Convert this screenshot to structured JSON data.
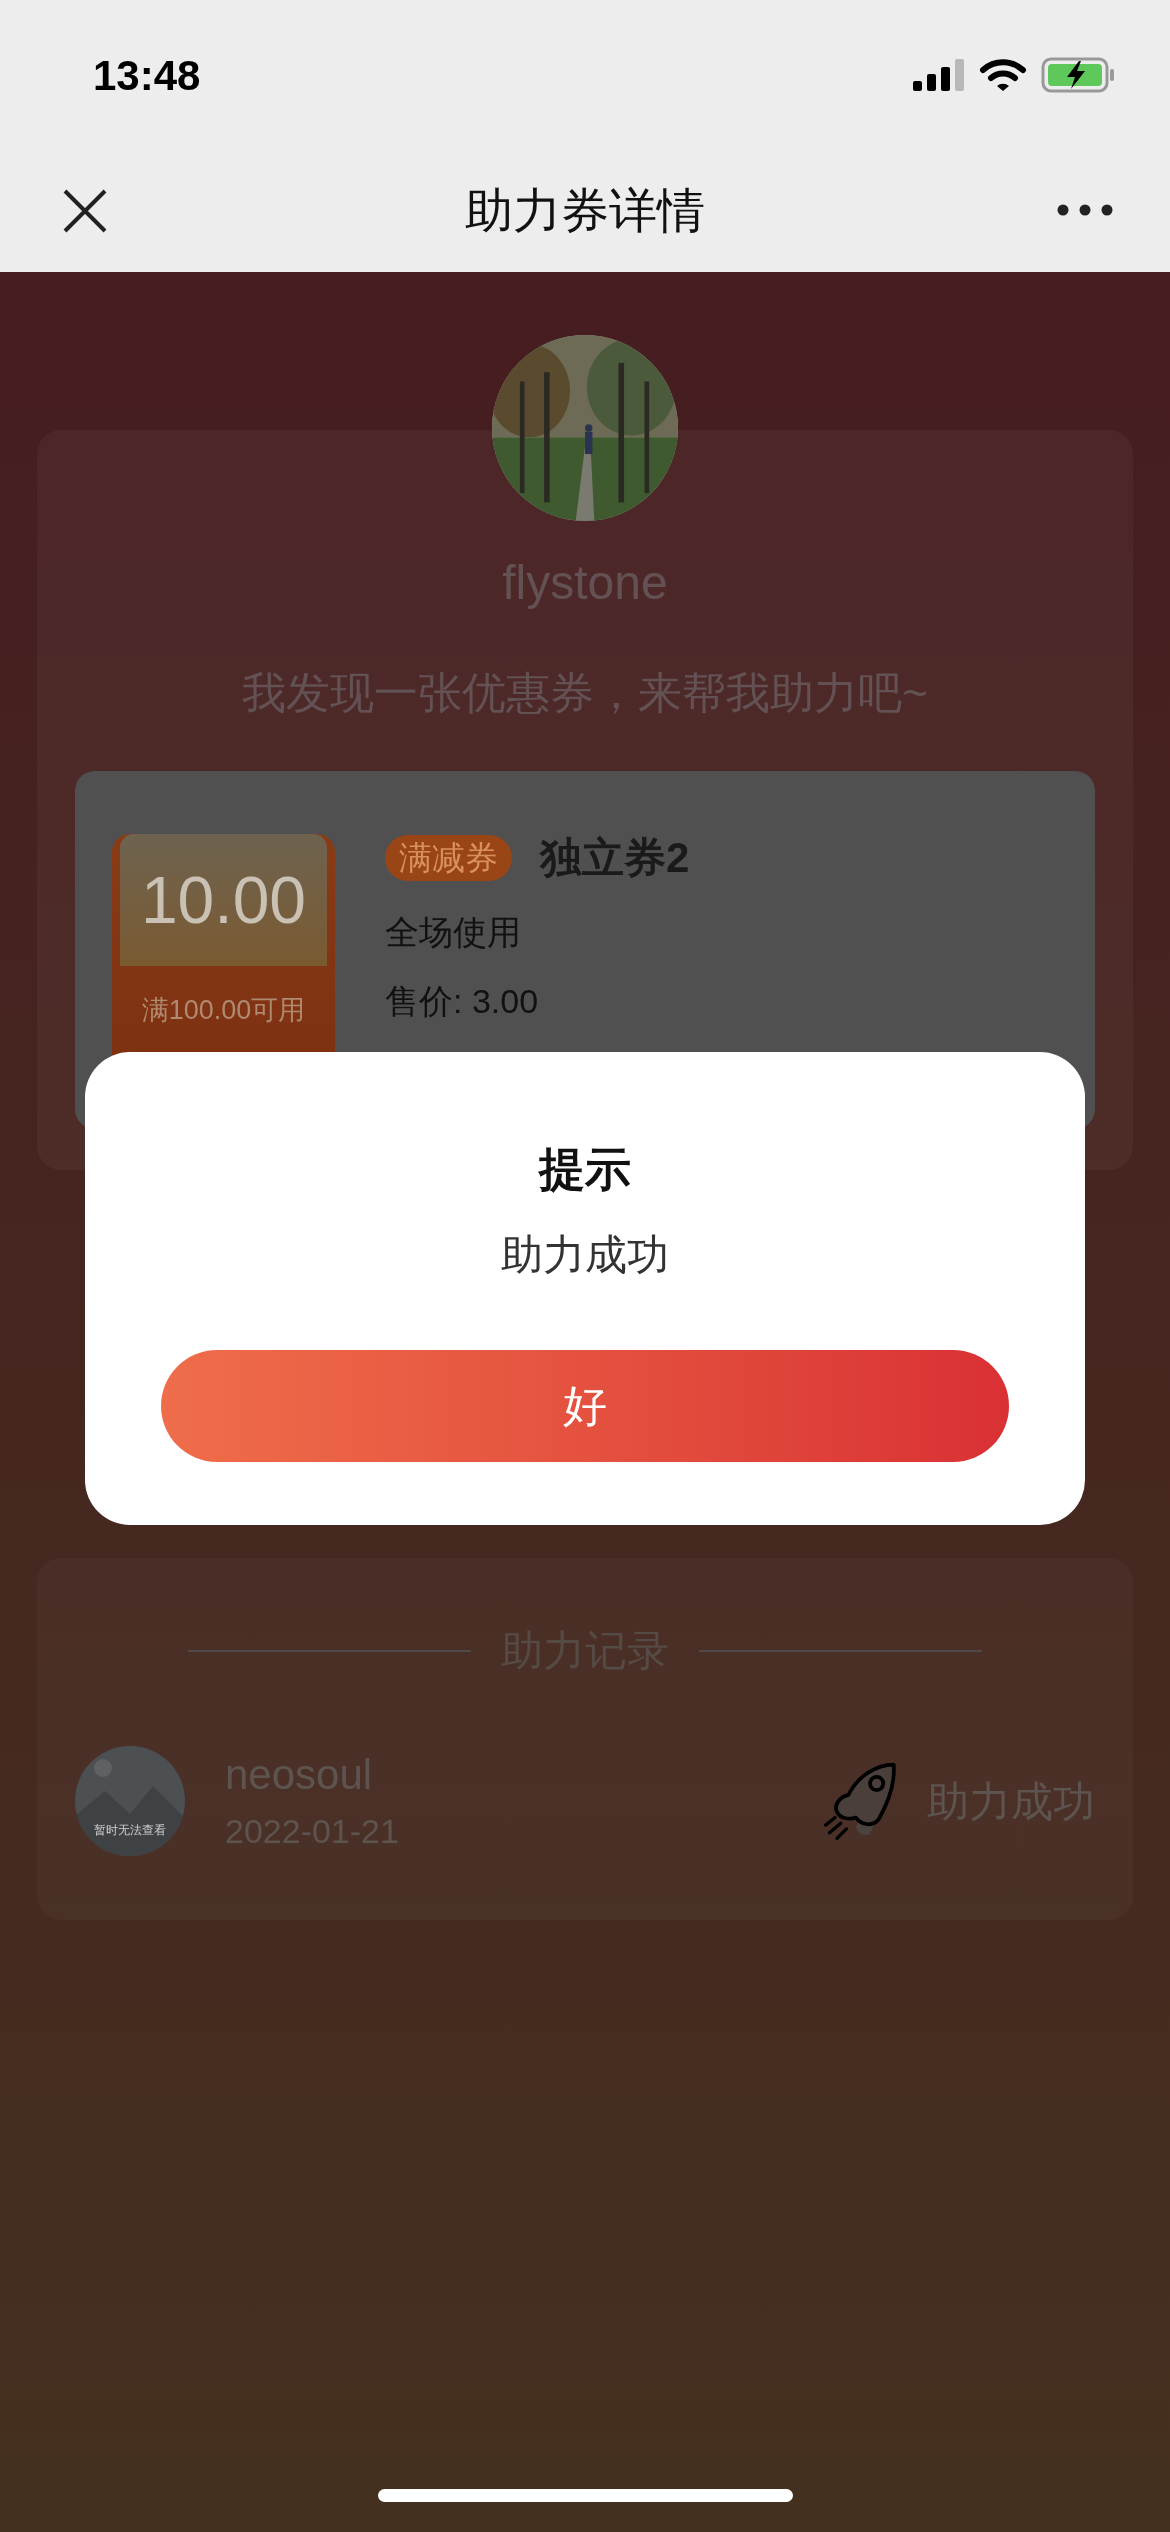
{
  "status_bar": {
    "time": "13:48"
  },
  "nav": {
    "title": "助力券详情"
  },
  "sharer": {
    "name": "flystone",
    "message": "我发现一张优惠券，来帮我助力吧~"
  },
  "coupon": {
    "amount": "10.00",
    "condition": "满100.00可用",
    "tag": "满减券",
    "title": "独立券2",
    "scope": "全场使用",
    "price": "售价: 3.00"
  },
  "dialog": {
    "title": "提示",
    "message": "助力成功",
    "button": "好"
  },
  "records": {
    "heading": "助力记录",
    "items": [
      {
        "name": "neosoul",
        "date": "2022-01-21",
        "avatar_note": "暂时无法查看",
        "status": "助力成功"
      }
    ]
  }
}
